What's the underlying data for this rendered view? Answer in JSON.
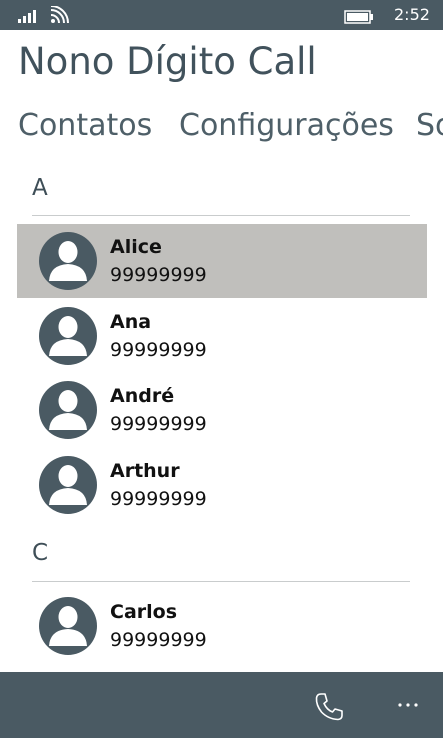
{
  "status_bar": {
    "time": "2:52",
    "icons": [
      "signal-icon",
      "wifi-icon",
      "battery-icon"
    ]
  },
  "app": {
    "title": "Nono Dígito Call"
  },
  "pivot": {
    "items": [
      "Contatos",
      "Configurações",
      "Sobre"
    ],
    "active_index": 0
  },
  "contacts": {
    "groups": [
      {
        "letter": "A",
        "items": [
          {
            "name": "Alice",
            "phone": "99999999",
            "selected": true
          },
          {
            "name": "Ana",
            "phone": "99999999",
            "selected": false
          },
          {
            "name": "André",
            "phone": "99999999",
            "selected": false
          },
          {
            "name": "Arthur",
            "phone": "99999999",
            "selected": false
          }
        ]
      },
      {
        "letter": "C",
        "items": [
          {
            "name": "Carlos",
            "phone": "99999999",
            "selected": false
          }
        ]
      }
    ]
  },
  "app_bar": {
    "icons": [
      "phone-icon",
      "more-icon"
    ]
  },
  "colors": {
    "chrome": "#4a5a63",
    "selected_row": "#c0bfbc",
    "avatar": "#4a5a63",
    "title_text": "#41525c"
  }
}
